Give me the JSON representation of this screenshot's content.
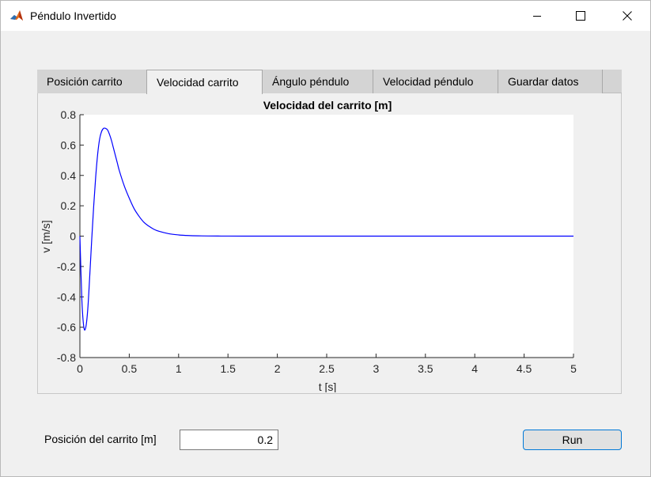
{
  "window": {
    "title": "Péndulo Invertido",
    "icon": "matlab-icon"
  },
  "tabs": [
    {
      "label": "Posición carrito",
      "active": false
    },
    {
      "label": "Velocidad carrito",
      "active": true
    },
    {
      "label": "Ángulo péndulo",
      "active": false
    },
    {
      "label": "Velocidad péndulo",
      "active": false
    },
    {
      "label": "Guardar datos",
      "active": false
    }
  ],
  "controls": {
    "position_label": "Posición del carrito [m]",
    "position_value": "0.2",
    "run_label": "Run"
  },
  "chart_data": {
    "type": "line",
    "title": "Velocidad del carrito [m]",
    "xlabel": "t [s]",
    "ylabel": "v [m/s]",
    "xlim": [
      0,
      5
    ],
    "ylim": [
      -0.8,
      0.8
    ],
    "xticks": [
      "0",
      "0.5",
      "1",
      "1.5",
      "2",
      "2.5",
      "3",
      "3.5",
      "4",
      "4.5",
      "5"
    ],
    "yticks": [
      "0.8",
      "0.6",
      "0.4",
      "0.2",
      "0",
      "-0.2",
      "-0.4",
      "-0.6",
      "-0.8"
    ],
    "grid": false,
    "series": [
      {
        "color": "#0000ff",
        "x": [
          0,
          0.02,
          0.04,
          0.06,
          0.08,
          0.1,
          0.12,
          0.14,
          0.16,
          0.18,
          0.2,
          0.22,
          0.24,
          0.26,
          0.28,
          0.3,
          0.32,
          0.34,
          0.36,
          0.38,
          0.4,
          0.45,
          0.5,
          0.55,
          0.6,
          0.65,
          0.7,
          0.75,
          0.8,
          0.9,
          1.0,
          1.1,
          1.2,
          1.3,
          1.4,
          1.5,
          1.75,
          2.0,
          2.5,
          3.0,
          3.5,
          4.0,
          4.5,
          5.0
        ],
        "y": [
          0,
          -0.42,
          -0.6,
          -0.6,
          -0.48,
          -0.26,
          -0.02,
          0.2,
          0.39,
          0.54,
          0.64,
          0.69,
          0.71,
          0.71,
          0.7,
          0.67,
          0.63,
          0.58,
          0.53,
          0.48,
          0.43,
          0.33,
          0.25,
          0.18,
          0.13,
          0.09,
          0.065,
          0.045,
          0.032,
          0.016,
          0.008,
          0.004,
          0.002,
          0.001,
          0.0005,
          0.0002,
          0,
          0,
          0,
          0,
          0,
          0,
          0,
          0
        ]
      }
    ]
  }
}
